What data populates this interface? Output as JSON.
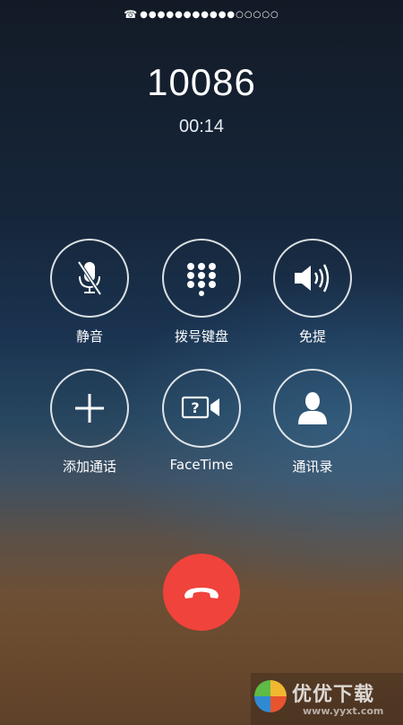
{
  "status_bar": {
    "icon": "phone-icon",
    "signal_dots": "●●●●●●●●●●●○○○○○"
  },
  "call": {
    "number": "10086",
    "duration": "00:14"
  },
  "controls": [
    {
      "label": "静音",
      "icon": "muted-microphone-icon"
    },
    {
      "label": "拨号键盘",
      "icon": "keypad-icon"
    },
    {
      "label": "免提",
      "icon": "speaker-icon"
    },
    {
      "label": "添加通话",
      "icon": "plus-icon"
    },
    {
      "label": "FaceTime",
      "icon": "facetime-icon"
    },
    {
      "label": "通讯录",
      "icon": "contact-person-icon"
    }
  ],
  "end_call": {
    "icon": "end-call-icon",
    "color": "#f0433b"
  },
  "watermark": {
    "text": "优优下载",
    "url": "www.yyxt.com"
  }
}
